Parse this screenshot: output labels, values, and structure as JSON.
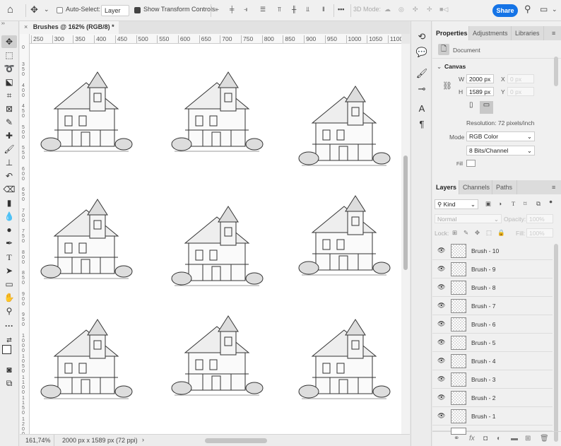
{
  "options_bar": {
    "auto_select_label": "Auto-Select:",
    "auto_select_value": "Layer",
    "show_transform_label": "Show Transform Controls",
    "three_d_label": "3D Mode:",
    "share_label": "Share"
  },
  "document": {
    "tab_title": "Brushes @ 162% (RGB/8) *",
    "close": "×"
  },
  "rulers": {
    "horizontal": [
      "250",
      "300",
      "350",
      "400",
      "450",
      "500",
      "550",
      "600",
      "650",
      "700",
      "750",
      "800",
      "850",
      "900",
      "950",
      "1000",
      "1050",
      "1100"
    ],
    "vertical": [
      "0",
      "350",
      "400",
      "450",
      "500",
      "550",
      "600",
      "650",
      "700",
      "750",
      "800",
      "850",
      "900",
      "950",
      "1000",
      "1050",
      "1100",
      "1150",
      "1200"
    ]
  },
  "status": {
    "zoom": "161,74%",
    "doc_info": "2000 px x 1589 px (72 ppi)",
    "arrow": "›"
  },
  "properties": {
    "tabs": [
      "Properties",
      "Adjustments",
      "Libraries"
    ],
    "doc_label": "Document",
    "canvas_header": "Canvas",
    "w_label": "W",
    "w_value": "2000 px",
    "h_label": "H",
    "h_value": "1589 px",
    "x_label": "X",
    "x_value": "0 px",
    "y_label": "Y",
    "y_value": "0 px",
    "resolution": "Resolution: 72 pixels/inch",
    "mode_label": "Mode",
    "mode_value": "RGB Color",
    "bits_value": "8 Bits/Channel",
    "fill_label": "Fill"
  },
  "layers_panel": {
    "tabs": [
      "Layers",
      "Channels",
      "Paths"
    ],
    "filter_kind": "Kind",
    "blend_mode": "Normal",
    "opacity_label": "Opacity:",
    "opacity_value": "100%",
    "lock_label": "Lock:",
    "fill_label": "Fill:",
    "fill_value": "100%",
    "layers": [
      {
        "name": "Brush - 10"
      },
      {
        "name": "Brush - 9"
      },
      {
        "name": "Brush - 8"
      },
      {
        "name": "Brush - 7"
      },
      {
        "name": "Brush - 6"
      },
      {
        "name": "Brush - 5"
      },
      {
        "name": "Brush - 4"
      },
      {
        "name": "Brush - 3"
      },
      {
        "name": "Brush - 2"
      },
      {
        "name": "Brush - 1"
      }
    ]
  }
}
